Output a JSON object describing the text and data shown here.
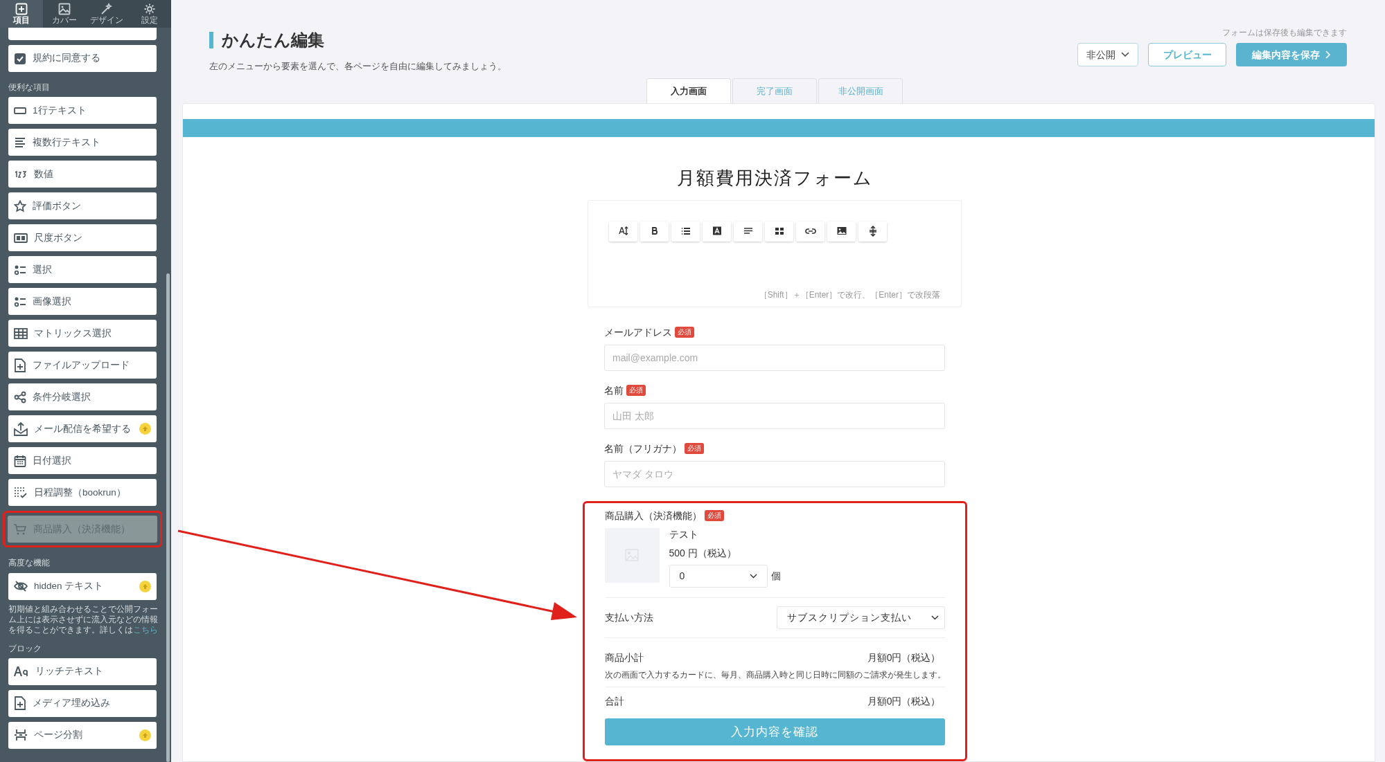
{
  "sidebar": {
    "tabs": [
      {
        "label": "項目",
        "selected": true
      },
      {
        "label": "カバー",
        "selected": false
      },
      {
        "label": "デザイン",
        "selected": false
      },
      {
        "label": "設定",
        "selected": false
      }
    ],
    "sections": [
      {
        "items": [
          {
            "label": "規約に同意する",
            "upgrade": false,
            "selected": false,
            "highlighted": false
          }
        ]
      },
      {
        "heading": "便利な項目",
        "items": [
          {
            "label": "1行テキスト",
            "upgrade": false,
            "selected": false,
            "highlighted": false
          },
          {
            "label": "複数行テキスト",
            "upgrade": false,
            "selected": false,
            "highlighted": false
          },
          {
            "label": "数値",
            "upgrade": false,
            "selected": false,
            "highlighted": false
          },
          {
            "label": "評価ボタン",
            "upgrade": false,
            "selected": false,
            "highlighted": false
          },
          {
            "label": "尺度ボタン",
            "upgrade": false,
            "selected": false,
            "highlighted": false
          },
          {
            "label": "選択",
            "upgrade": false,
            "selected": false,
            "highlighted": false
          },
          {
            "label": "画像選択",
            "upgrade": false,
            "selected": false,
            "highlighted": false
          },
          {
            "label": "マトリックス選択",
            "upgrade": false,
            "selected": false,
            "highlighted": false
          },
          {
            "label": "ファイルアップロード",
            "upgrade": false,
            "selected": false,
            "highlighted": false
          },
          {
            "label": "条件分岐選択",
            "upgrade": false,
            "selected": false,
            "highlighted": false
          },
          {
            "label": "メール配信を希望する",
            "upgrade": true,
            "selected": false,
            "highlighted": false
          },
          {
            "label": "日付選択",
            "upgrade": false,
            "selected": false,
            "highlighted": false
          },
          {
            "label": "日程調整（bookrun）",
            "upgrade": false,
            "selected": false,
            "highlighted": false
          },
          {
            "label": "商品購入（決済機能）",
            "upgrade": false,
            "selected": true,
            "highlighted": true
          }
        ]
      },
      {
        "heading": "高度な機能",
        "items": [
          {
            "label": "hidden テキスト",
            "upgrade": true,
            "selected": false,
            "highlighted": false
          }
        ],
        "note": "初期値と組み合わせることで公開フォーム上には表示させずに流入元などの情報を得ることができます。詳しくは",
        "note_link": "こちら"
      },
      {
        "heading": "ブロック",
        "items": [
          {
            "label": "リッチテキスト",
            "upgrade": false,
            "selected": false,
            "highlighted": false
          },
          {
            "label": "メディア埋め込み",
            "upgrade": false,
            "selected": false,
            "highlighted": false
          },
          {
            "label": "ページ分割",
            "upgrade": true,
            "selected": false,
            "highlighted": false
          }
        ]
      }
    ]
  },
  "header": {
    "title": "かんたん編集",
    "subtitle": "左のメニューから要素を選んで、各ページを自由に編集してみましょう。",
    "save_note": "フォームは保存後も編集できます",
    "visibility": "非公開",
    "preview_button": "プレビュー",
    "save_button": "編集内容を保存"
  },
  "tabs": [
    {
      "label": "入力画面",
      "selected": true
    },
    {
      "label": "完了画面",
      "selected": false
    },
    {
      "label": "非公開画面",
      "selected": false
    }
  ],
  "form": {
    "title": "月額費用決済フォーム",
    "editor_hint": "［Shift］＋［Enter］で改行、［Enter］で改段落",
    "fields": [
      {
        "label": "メールアドレス",
        "required_badge": "必須",
        "placeholder": "mail@example.com"
      },
      {
        "label": "名前",
        "required_badge": "必須",
        "placeholder": "山田 太郎"
      },
      {
        "label": "名前（フリガナ）",
        "required_badge": "必須",
        "placeholder": "ヤマダ タロウ"
      }
    ],
    "product": {
      "label": "商品購入（決済機能）",
      "required_badge": "必須",
      "highlighted": true,
      "name": "テスト",
      "price": "500 円（税込）",
      "quantity": "0",
      "unit": "個",
      "payment_label": "支払い方法",
      "payment_method": "サブスクリプション支払い",
      "subtotal_label": "商品小計",
      "subtotal": "月額0円（税込）",
      "notice": "次の画面で入力するカードに、毎月、商品購入時と同じ日時に同額のご請求が発生します。",
      "total_label": "合計",
      "total": "月額0円（税込）"
    },
    "submit_button": "入力内容を確認"
  }
}
